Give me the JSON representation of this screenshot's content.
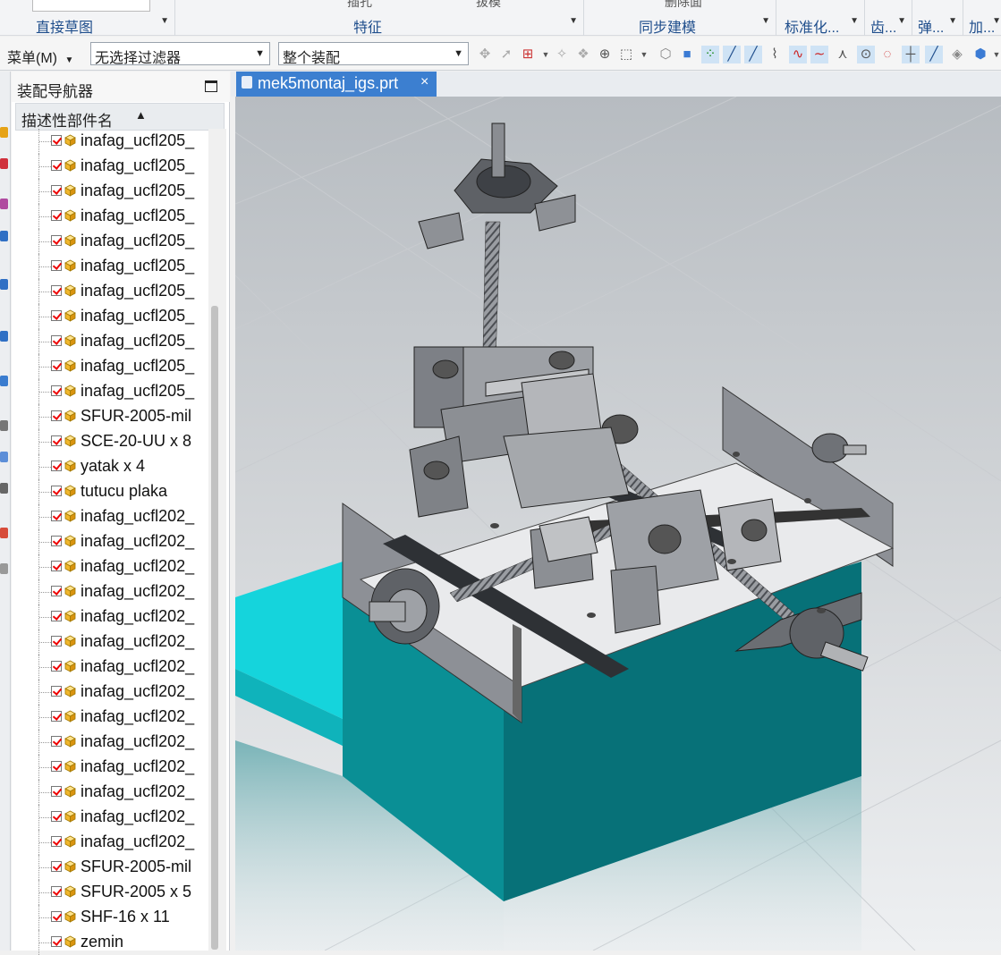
{
  "ribbon": {
    "groups": [
      {
        "label": "直接草图"
      },
      {
        "label": "特征"
      },
      {
        "label": "同步建模"
      },
      {
        "label": "标准化..."
      },
      {
        "label": "齿..."
      },
      {
        "label": "弹..."
      },
      {
        "label": "加..."
      }
    ],
    "peek_texts": [
      "插孔",
      "拔模",
      "删除面"
    ]
  },
  "toolbar": {
    "menu_label": "菜单(M)",
    "selection_filter": "无选择过滤器",
    "scope": "整个装配"
  },
  "navigator": {
    "title": "装配导航器",
    "column_header": "描述性部件名",
    "items": [
      {
        "label": "inafag_ucfl205_"
      },
      {
        "label": "inafag_ucfl205_"
      },
      {
        "label": "inafag_ucfl205_"
      },
      {
        "label": "inafag_ucfl205_"
      },
      {
        "label": "inafag_ucfl205_"
      },
      {
        "label": "inafag_ucfl205_"
      },
      {
        "label": "inafag_ucfl205_"
      },
      {
        "label": "inafag_ucfl205_"
      },
      {
        "label": "inafag_ucfl205_"
      },
      {
        "label": "inafag_ucfl205_"
      },
      {
        "label": "inafag_ucfl205_"
      },
      {
        "label": "SFUR-2005-mil"
      },
      {
        "label": "SCE-20-UU x 8"
      },
      {
        "label": "yatak x 4"
      },
      {
        "label": "tutucu plaka"
      },
      {
        "label": "inafag_ucfl202_"
      },
      {
        "label": "inafag_ucfl202_"
      },
      {
        "label": "inafag_ucfl202_"
      },
      {
        "label": "inafag_ucfl202_"
      },
      {
        "label": "inafag_ucfl202_"
      },
      {
        "label": "inafag_ucfl202_"
      },
      {
        "label": "inafag_ucfl202_"
      },
      {
        "label": "inafag_ucfl202_"
      },
      {
        "label": "inafag_ucfl202_"
      },
      {
        "label": "inafag_ucfl202_"
      },
      {
        "label": "inafag_ucfl202_"
      },
      {
        "label": "inafag_ucfl202_"
      },
      {
        "label": "inafag_ucfl202_"
      },
      {
        "label": "inafag_ucfl202_"
      },
      {
        "label": "SFUR-2005-mil"
      },
      {
        "label": "SFUR-2005 x 5"
      },
      {
        "label": "SHF-16 x 11"
      },
      {
        "label": "zemin"
      }
    ]
  },
  "document_tab": {
    "name": "mek5montaj_igs.prt",
    "close": "×"
  },
  "colors": {
    "accent": "#3c7fd0",
    "base_teal": "#0a7f86",
    "base_top": "#15d4dc",
    "frame_grey": "#8d9096"
  },
  "icons": [
    "part-file-icon",
    "checkbox-checked-icon",
    "component-cube-icon",
    "maximize-icon",
    "sort-ascending-icon",
    "close-icon"
  ]
}
